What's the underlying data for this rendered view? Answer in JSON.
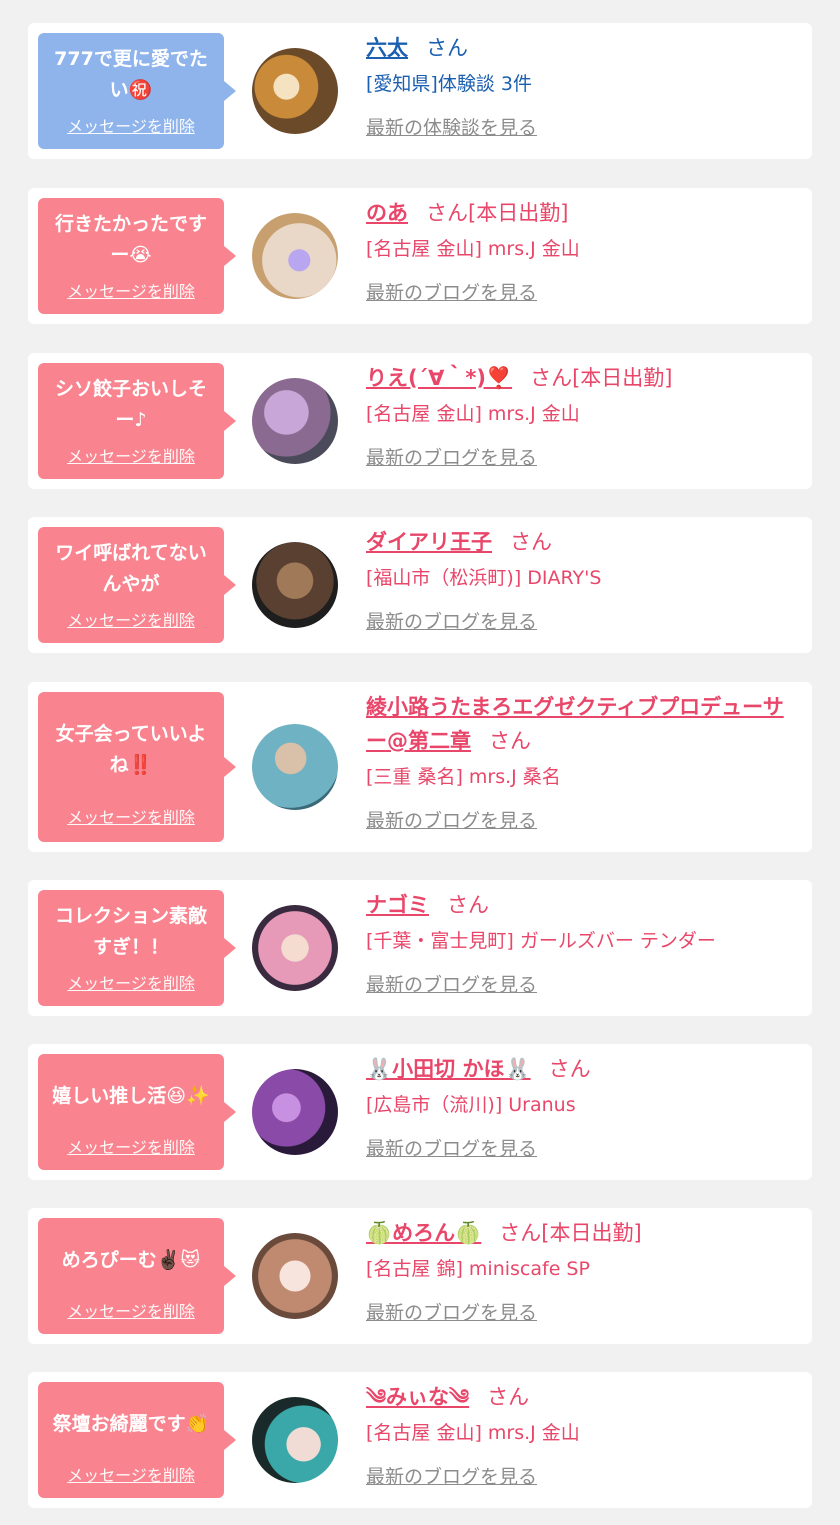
{
  "delete_label": "メッセージを削除",
  "san_label": "さん",
  "items": [
    {
      "message": "777で更に愛でたい㊗️",
      "name": "六太",
      "status": "",
      "shop": "[愛知県]体験談 3件",
      "link": "最新の体験談を見る",
      "bubble_color": "#8fb4ec",
      "text_color": "#1b5fb0",
      "avatar_colors": [
        "#c98a3a",
        "#6b4a2a"
      ]
    },
    {
      "message": "行きたかったですー😭",
      "name": "のあ",
      "status": "[本日出勤]",
      "shop": "[名古屋 金山] mrs.J 金山",
      "link": "最新のブログを見る",
      "bubble_color": "#f9848f",
      "text_color": "#e8476a",
      "avatar_colors": [
        "#e9d7c8",
        "#8a7fe0"
      ]
    },
    {
      "message": "シソ餃子おいしそー♪",
      "name": "りえ(´∀｀*)❣️",
      "status": "[本日出勤]",
      "shop": "[名古屋 金山] mrs.J 金山",
      "link": "最新のブログを見る",
      "bubble_color": "#f9848f",
      "text_color": "#e8476a",
      "avatar_colors": [
        "#b08ab8",
        "#5a4a60"
      ]
    },
    {
      "message": "ワイ呼ばれてないんやが",
      "name": "ダイアリ王子",
      "status": "",
      "shop": "[福山市（松浜町)] DIARY'S",
      "link": "最新のブログを見る",
      "bubble_color": "#f9848f",
      "text_color": "#e8476a",
      "avatar_colors": [
        "#7a5a40",
        "#2a2a2a"
      ]
    },
    {
      "message": "女子会っていいよね‼️",
      "name": "綾小路うたまろエグゼクティブプロデューサー@第二章",
      "status": "",
      "shop": "[三重 桑名] mrs.J 桑名",
      "link": "最新のブログを見る",
      "bubble_color": "#f9848f",
      "text_color": "#e8476a",
      "avatar_colors": [
        "#6fb2c4",
        "#d9c0a8"
      ]
    },
    {
      "message": "コレクション素敵すぎ！！",
      "name": "ナゴミ",
      "status": "",
      "shop": "[千葉・富士見町] ガールズバー テンダー",
      "link": "最新のブログを見る",
      "bubble_color": "#f9848f",
      "text_color": "#e8476a",
      "avatar_colors": [
        "#e79ab8",
        "#3a2a40"
      ]
    },
    {
      "message": "嬉しい推し活😆✨",
      "name": "🐰小田切 かほ🐰",
      "status": "",
      "shop": "[広島市（流川)] Uranus",
      "link": "最新のブログを見る",
      "bubble_color": "#f9848f",
      "text_color": "#e8476a",
      "avatar_colors": [
        "#8a4aa8",
        "#2a1a3a"
      ]
    },
    {
      "message": "めろぴーむ✌🏿😻",
      "name": "🍈めろん🍈",
      "status": "[本日出勤]",
      "shop": "[名古屋 錦] miniscafe SP",
      "link": "最新のブログを見る",
      "bubble_color": "#f9848f",
      "text_color": "#e8476a",
      "avatar_colors": [
        "#f0d8cc",
        "#a06a50"
      ]
    },
    {
      "message": "祭壇お綺麗です👏",
      "name": "༄みぃな༄",
      "status": "",
      "shop": "[名古屋 金山] mrs.J 金山",
      "link": "最新のブログを見る",
      "bubble_color": "#f9848f",
      "text_color": "#e8476a",
      "avatar_colors": [
        "#3aa8a8",
        "#1a2a2a"
      ]
    }
  ]
}
